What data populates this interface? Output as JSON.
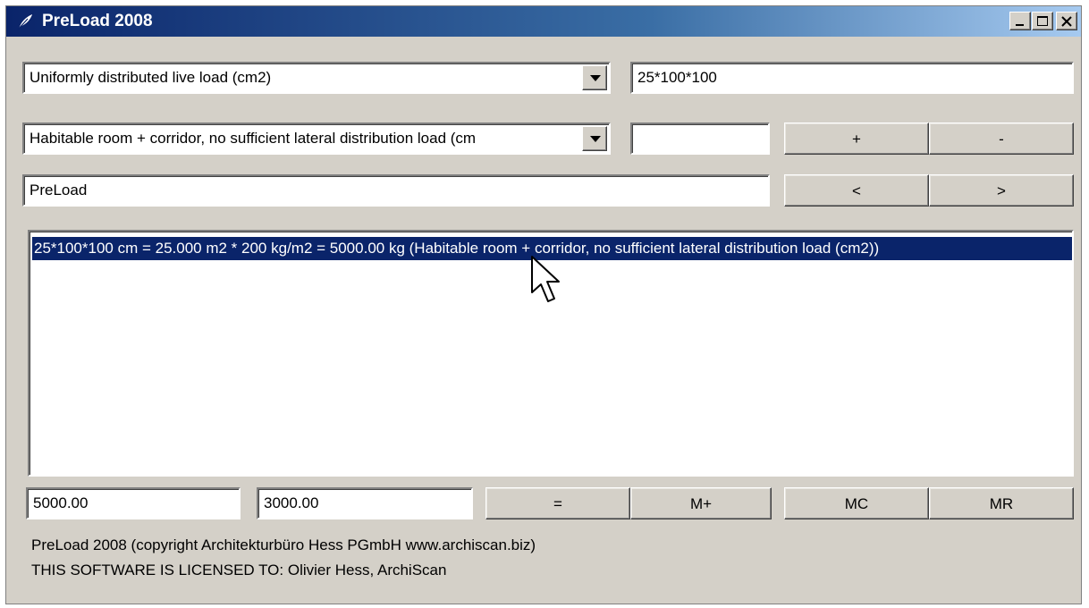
{
  "window": {
    "title": "PreLoad 2008"
  },
  "row1": {
    "load_type": "Uniformly distributed live load (cm2)",
    "dimensions": "25*100*100"
  },
  "row2": {
    "category": "Habitable room + corridor, no sufficient lateral distribution load (cm",
    "value": "",
    "plus_label": "+",
    "minus_label": "-"
  },
  "row3": {
    "name": "PreLoad",
    "prev_label": "<",
    "next_label": ">"
  },
  "list": {
    "items": [
      "25*100*100 cm = 25.000 m2 * 200 kg/m2 = 5000.00 kg (Habitable room + corridor, no sufficient lateral distribution load (cm2))"
    ]
  },
  "calc": {
    "value1": "5000.00",
    "value2": "3000.00",
    "equals_label": "=",
    "mplus_label": "M+",
    "mc_label": "MC",
    "mr_label": "MR"
  },
  "footer": {
    "copyright": "PreLoad 2008 (copyright Architekturbüro Hess PGmbH www.archiscan.biz)",
    "license": "THIS SOFTWARE IS LICENSED TO: Olivier Hess, ArchiScan"
  },
  "icons": {
    "app": "feather-icon",
    "minimize": "minimize-icon",
    "maximize": "maximize-icon",
    "close": "close-icon",
    "dropdown": "chevron-down-icon",
    "cursor": "mouse-pointer-icon"
  }
}
